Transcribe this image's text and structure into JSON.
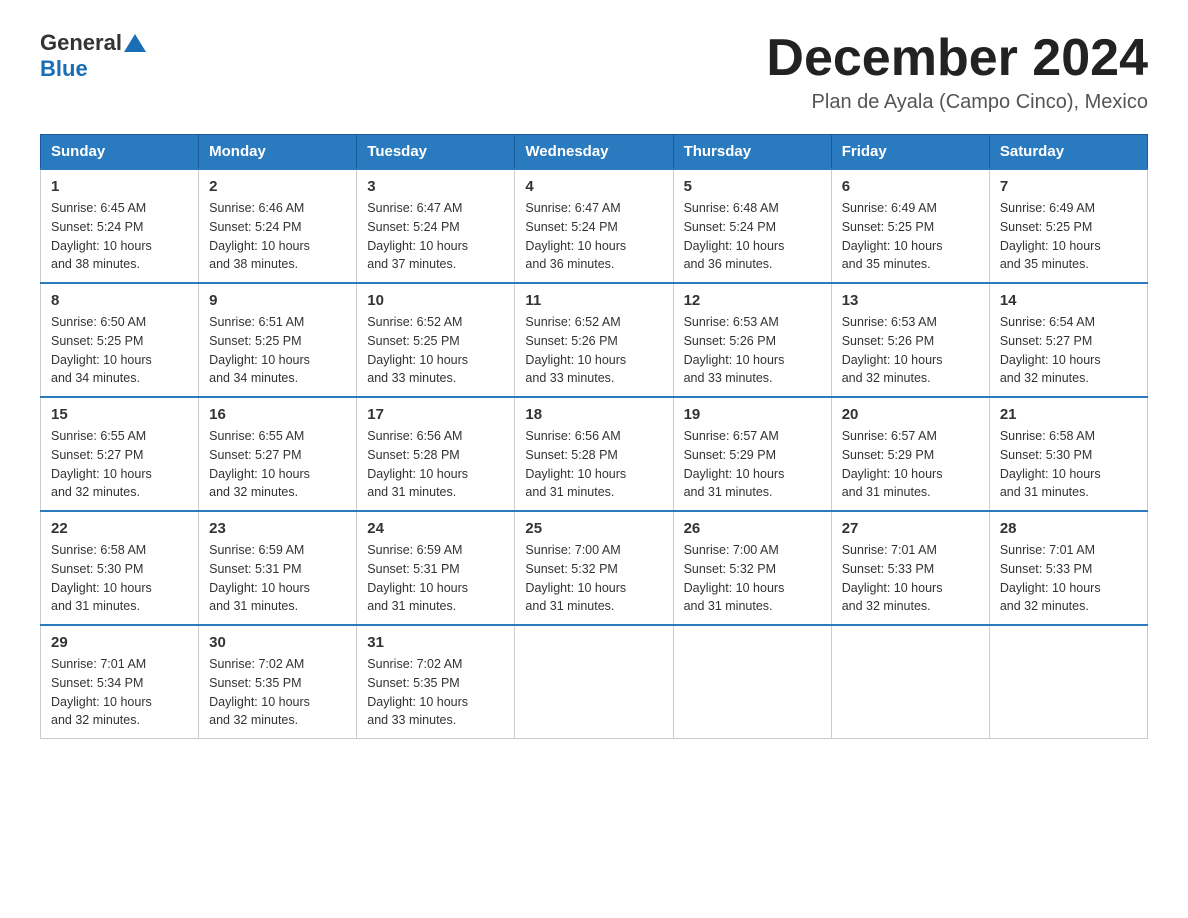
{
  "header": {
    "logo_general": "General",
    "logo_blue": "Blue",
    "month_title": "December 2024",
    "location": "Plan de Ayala (Campo Cinco), Mexico"
  },
  "days_of_week": [
    "Sunday",
    "Monday",
    "Tuesday",
    "Wednesday",
    "Thursday",
    "Friday",
    "Saturday"
  ],
  "weeks": [
    [
      {
        "day": "1",
        "sunrise": "6:45 AM",
        "sunset": "5:24 PM",
        "daylight": "10 hours and 38 minutes."
      },
      {
        "day": "2",
        "sunrise": "6:46 AM",
        "sunset": "5:24 PM",
        "daylight": "10 hours and 38 minutes."
      },
      {
        "day": "3",
        "sunrise": "6:47 AM",
        "sunset": "5:24 PM",
        "daylight": "10 hours and 37 minutes."
      },
      {
        "day": "4",
        "sunrise": "6:47 AM",
        "sunset": "5:24 PM",
        "daylight": "10 hours and 36 minutes."
      },
      {
        "day": "5",
        "sunrise": "6:48 AM",
        "sunset": "5:24 PM",
        "daylight": "10 hours and 36 minutes."
      },
      {
        "day": "6",
        "sunrise": "6:49 AM",
        "sunset": "5:25 PM",
        "daylight": "10 hours and 35 minutes."
      },
      {
        "day": "7",
        "sunrise": "6:49 AM",
        "sunset": "5:25 PM",
        "daylight": "10 hours and 35 minutes."
      }
    ],
    [
      {
        "day": "8",
        "sunrise": "6:50 AM",
        "sunset": "5:25 PM",
        "daylight": "10 hours and 34 minutes."
      },
      {
        "day": "9",
        "sunrise": "6:51 AM",
        "sunset": "5:25 PM",
        "daylight": "10 hours and 34 minutes."
      },
      {
        "day": "10",
        "sunrise": "6:52 AM",
        "sunset": "5:25 PM",
        "daylight": "10 hours and 33 minutes."
      },
      {
        "day": "11",
        "sunrise": "6:52 AM",
        "sunset": "5:26 PM",
        "daylight": "10 hours and 33 minutes."
      },
      {
        "day": "12",
        "sunrise": "6:53 AM",
        "sunset": "5:26 PM",
        "daylight": "10 hours and 33 minutes."
      },
      {
        "day": "13",
        "sunrise": "6:53 AM",
        "sunset": "5:26 PM",
        "daylight": "10 hours and 32 minutes."
      },
      {
        "day": "14",
        "sunrise": "6:54 AM",
        "sunset": "5:27 PM",
        "daylight": "10 hours and 32 minutes."
      }
    ],
    [
      {
        "day": "15",
        "sunrise": "6:55 AM",
        "sunset": "5:27 PM",
        "daylight": "10 hours and 32 minutes."
      },
      {
        "day": "16",
        "sunrise": "6:55 AM",
        "sunset": "5:27 PM",
        "daylight": "10 hours and 32 minutes."
      },
      {
        "day": "17",
        "sunrise": "6:56 AM",
        "sunset": "5:28 PM",
        "daylight": "10 hours and 31 minutes."
      },
      {
        "day": "18",
        "sunrise": "6:56 AM",
        "sunset": "5:28 PM",
        "daylight": "10 hours and 31 minutes."
      },
      {
        "day": "19",
        "sunrise": "6:57 AM",
        "sunset": "5:29 PM",
        "daylight": "10 hours and 31 minutes."
      },
      {
        "day": "20",
        "sunrise": "6:57 AM",
        "sunset": "5:29 PM",
        "daylight": "10 hours and 31 minutes."
      },
      {
        "day": "21",
        "sunrise": "6:58 AM",
        "sunset": "5:30 PM",
        "daylight": "10 hours and 31 minutes."
      }
    ],
    [
      {
        "day": "22",
        "sunrise": "6:58 AM",
        "sunset": "5:30 PM",
        "daylight": "10 hours and 31 minutes."
      },
      {
        "day": "23",
        "sunrise": "6:59 AM",
        "sunset": "5:31 PM",
        "daylight": "10 hours and 31 minutes."
      },
      {
        "day": "24",
        "sunrise": "6:59 AM",
        "sunset": "5:31 PM",
        "daylight": "10 hours and 31 minutes."
      },
      {
        "day": "25",
        "sunrise": "7:00 AM",
        "sunset": "5:32 PM",
        "daylight": "10 hours and 31 minutes."
      },
      {
        "day": "26",
        "sunrise": "7:00 AM",
        "sunset": "5:32 PM",
        "daylight": "10 hours and 31 minutes."
      },
      {
        "day": "27",
        "sunrise": "7:01 AM",
        "sunset": "5:33 PM",
        "daylight": "10 hours and 32 minutes."
      },
      {
        "day": "28",
        "sunrise": "7:01 AM",
        "sunset": "5:33 PM",
        "daylight": "10 hours and 32 minutes."
      }
    ],
    [
      {
        "day": "29",
        "sunrise": "7:01 AM",
        "sunset": "5:34 PM",
        "daylight": "10 hours and 32 minutes."
      },
      {
        "day": "30",
        "sunrise": "7:02 AM",
        "sunset": "5:35 PM",
        "daylight": "10 hours and 32 minutes."
      },
      {
        "day": "31",
        "sunrise": "7:02 AM",
        "sunset": "5:35 PM",
        "daylight": "10 hours and 33 minutes."
      },
      null,
      null,
      null,
      null
    ]
  ],
  "labels": {
    "sunrise": "Sunrise:",
    "sunset": "Sunset:",
    "daylight": "Daylight:"
  }
}
